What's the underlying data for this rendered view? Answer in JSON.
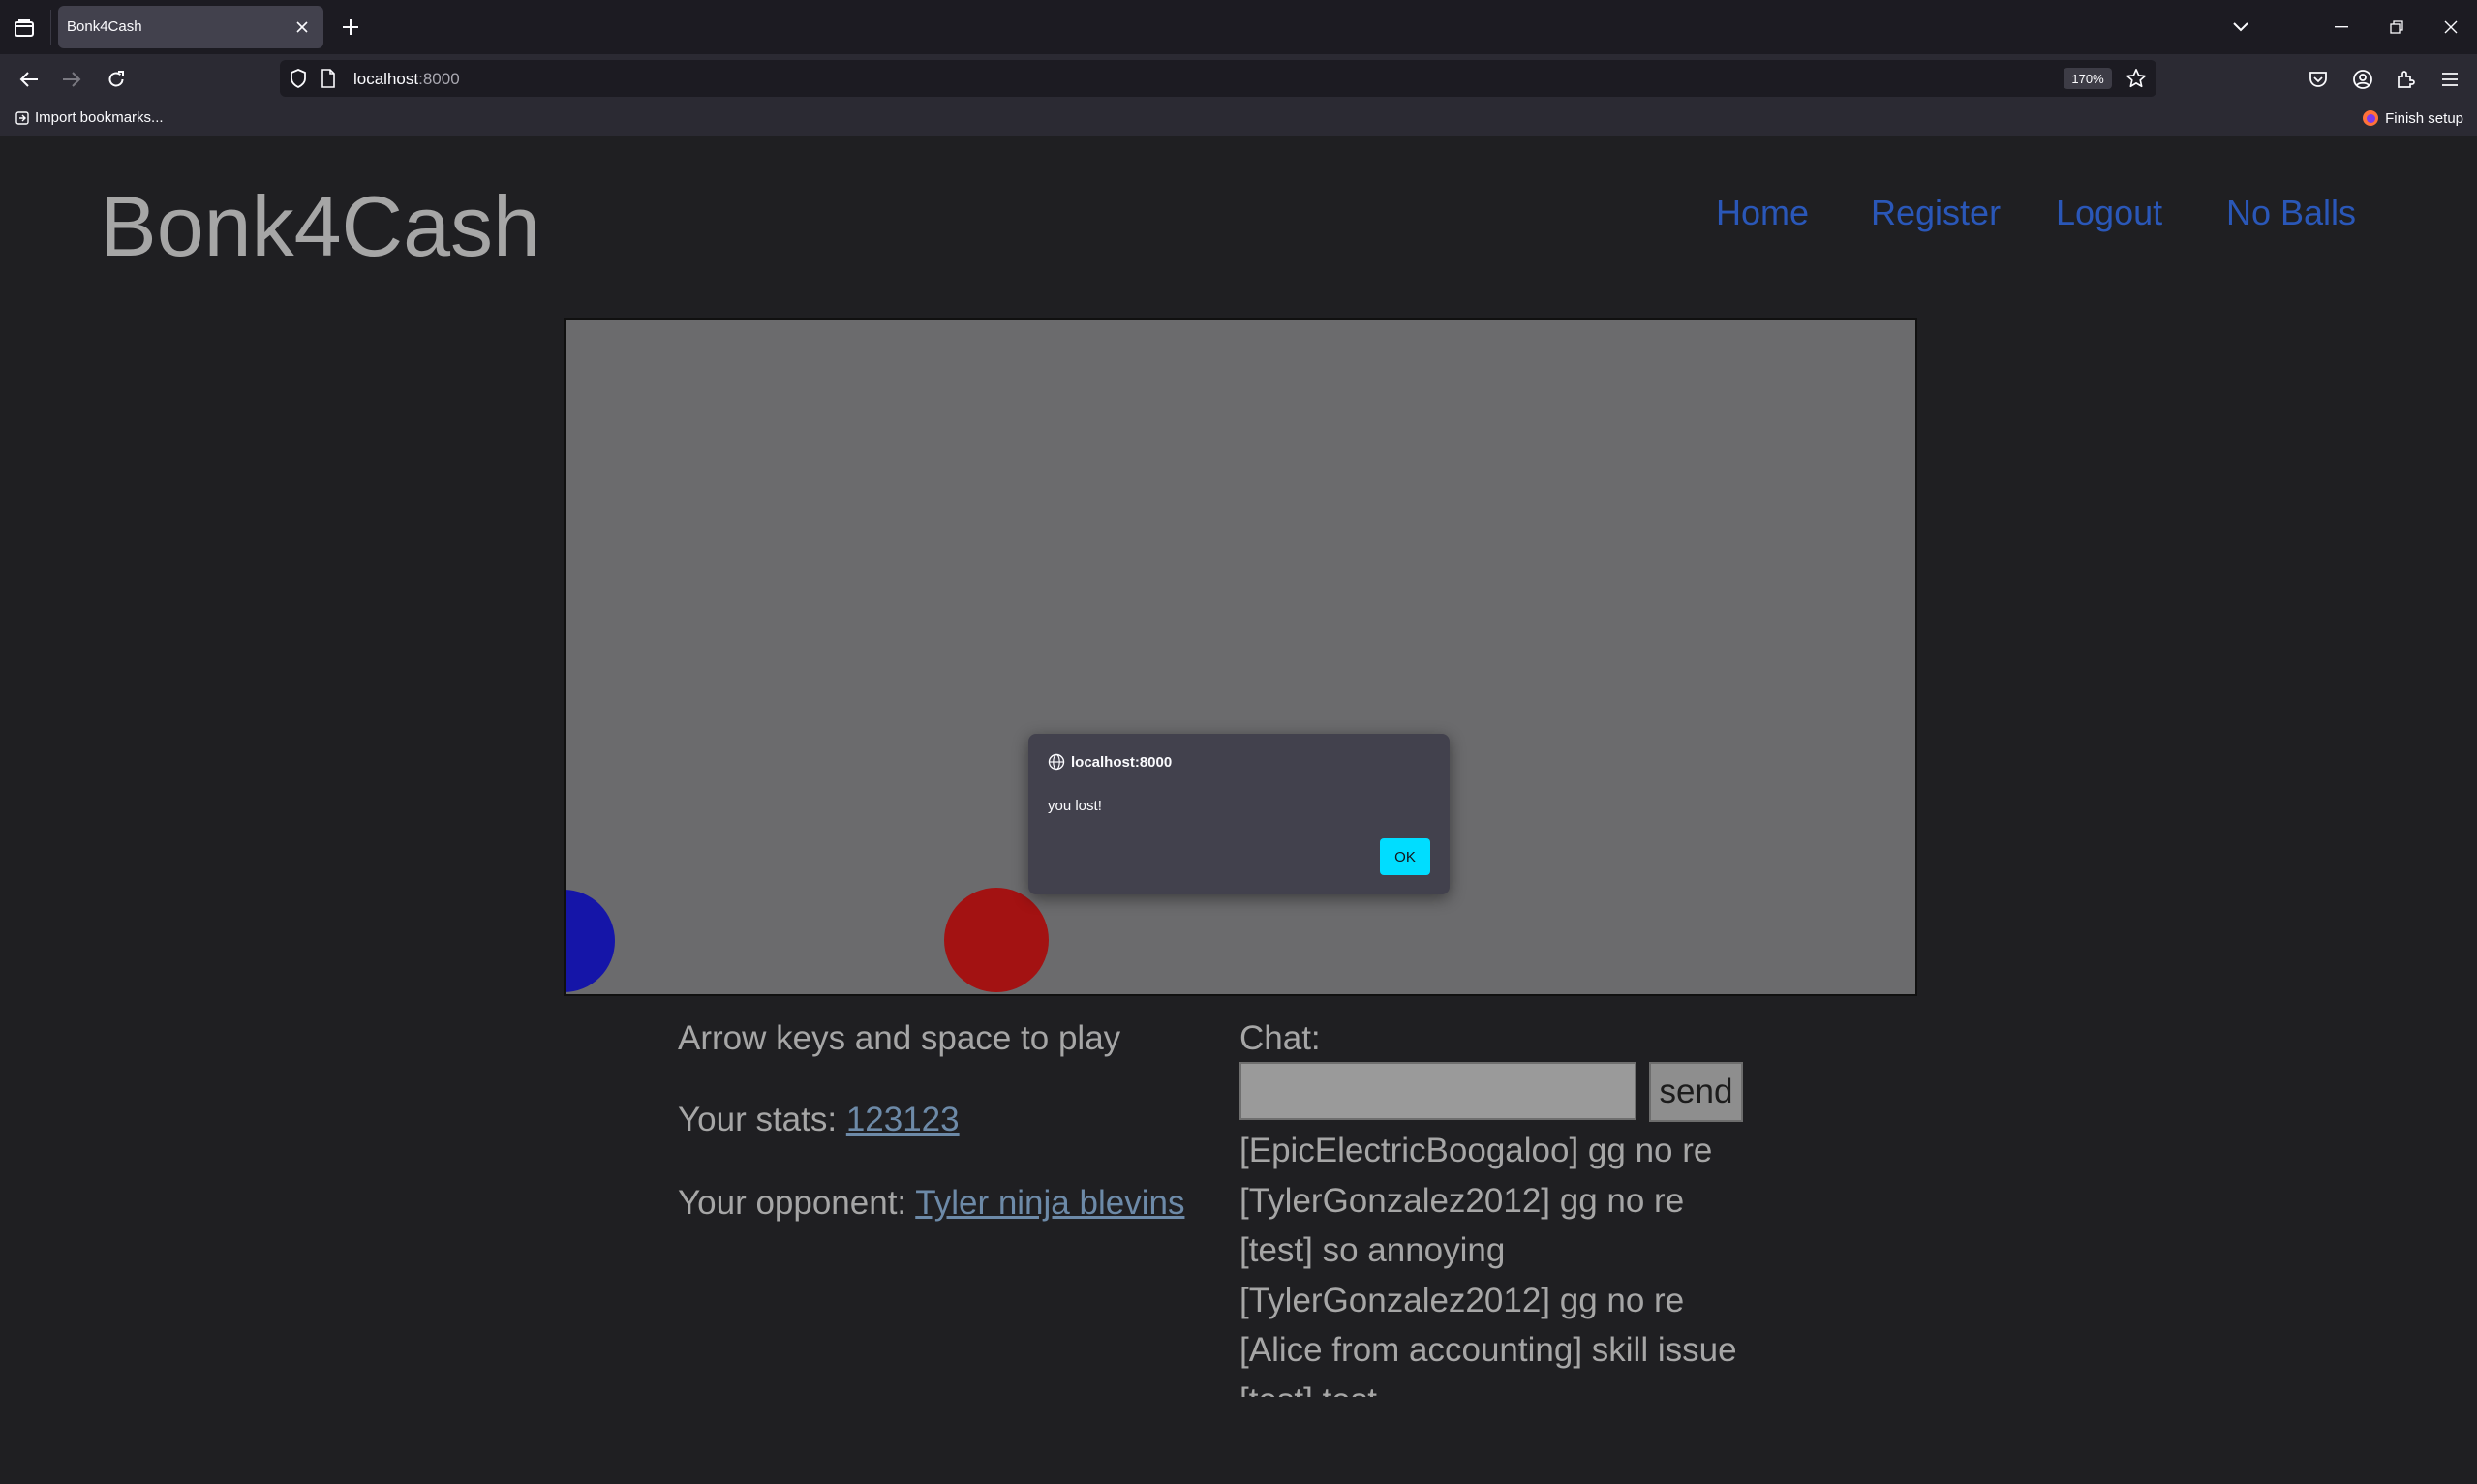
{
  "browser": {
    "tab_title": "Bonk4Cash",
    "url_host": "localhost",
    "url_port": ":8000",
    "zoom": "170%",
    "bookmarks": {
      "import_label": "Import bookmarks...",
      "finish_setup_label": "Finish setup"
    }
  },
  "site": {
    "title": "Bonk4Cash",
    "nav": [
      "Home",
      "Register",
      "Logout",
      "No Balls"
    ]
  },
  "game": {
    "balls": [
      {
        "name": "player-ball-blue",
        "color": "#1515a8"
      },
      {
        "name": "opponent-ball-red",
        "color": "#a31212"
      }
    ]
  },
  "dialog": {
    "origin": "localhost:8000",
    "message": "you lost!",
    "ok_label": "OK"
  },
  "info": {
    "instructions": "Arrow keys and space to play",
    "stats_label": "Your stats: ",
    "stats_value": "123123",
    "opponent_label": "Your opponent: ",
    "opponent_name": "Tyler ninja blevins"
  },
  "chat": {
    "label": "Chat:",
    "input_value": "",
    "send_label": "send",
    "messages": [
      "[EpicElectricBoogaloo] gg no re",
      "[TylerGonzalez2012] gg no re",
      "[test] so annoying",
      "[TylerGonzalez2012] gg no re",
      "[Alice from accounting] skill issue",
      "[test] test"
    ]
  },
  "colors": {
    "accent_link": "#2a57b8",
    "dialog_button": "#00ddff",
    "page_bg": "#1f1f22"
  }
}
